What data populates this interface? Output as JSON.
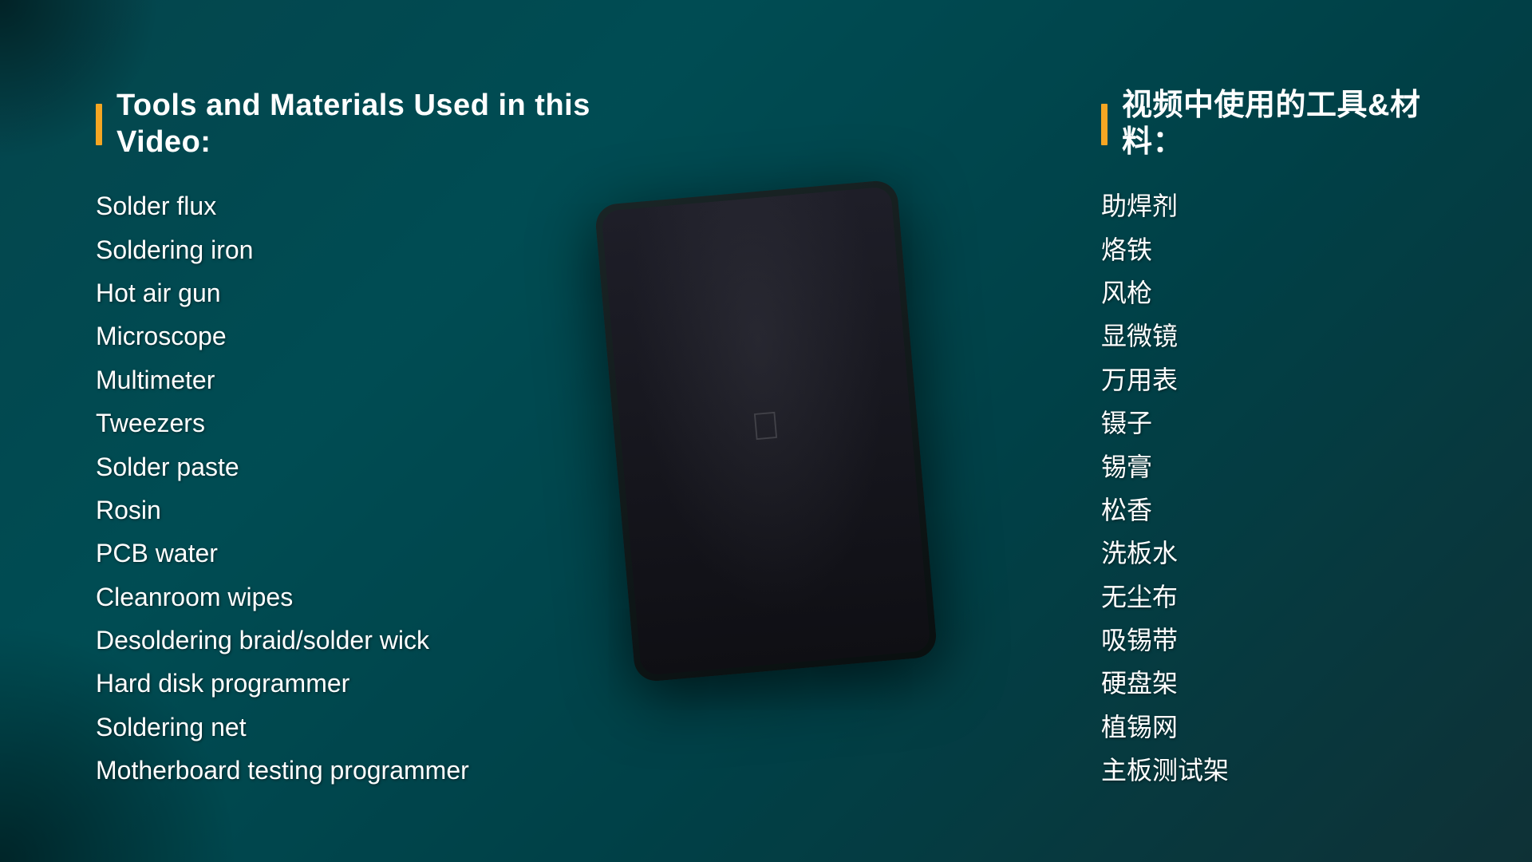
{
  "leftColumn": {
    "title": "Tools and Materials Used in this Video:",
    "items": [
      "Solder flux",
      "Soldering iron",
      "Hot air gun",
      "Microscope",
      "Multimeter",
      "Tweezers",
      "Solder paste",
      "Rosin",
      "PCB water",
      "Cleanroom wipes",
      "Desoldering braid/solder wick",
      "Hard disk programmer",
      "Soldering net",
      "Motherboard testing programmer"
    ]
  },
  "rightColumn": {
    "title": "视频中使用的工具&材料：",
    "items": [
      "助焊剂",
      "烙铁",
      "风枪",
      "显微镜",
      "万用表",
      "镊子",
      "锡膏",
      "松香",
      "洗板水",
      "无尘布",
      "吸锡带",
      "硬盘架",
      "植锡网",
      "主板测试架"
    ]
  },
  "accent_color": "#f5a623"
}
